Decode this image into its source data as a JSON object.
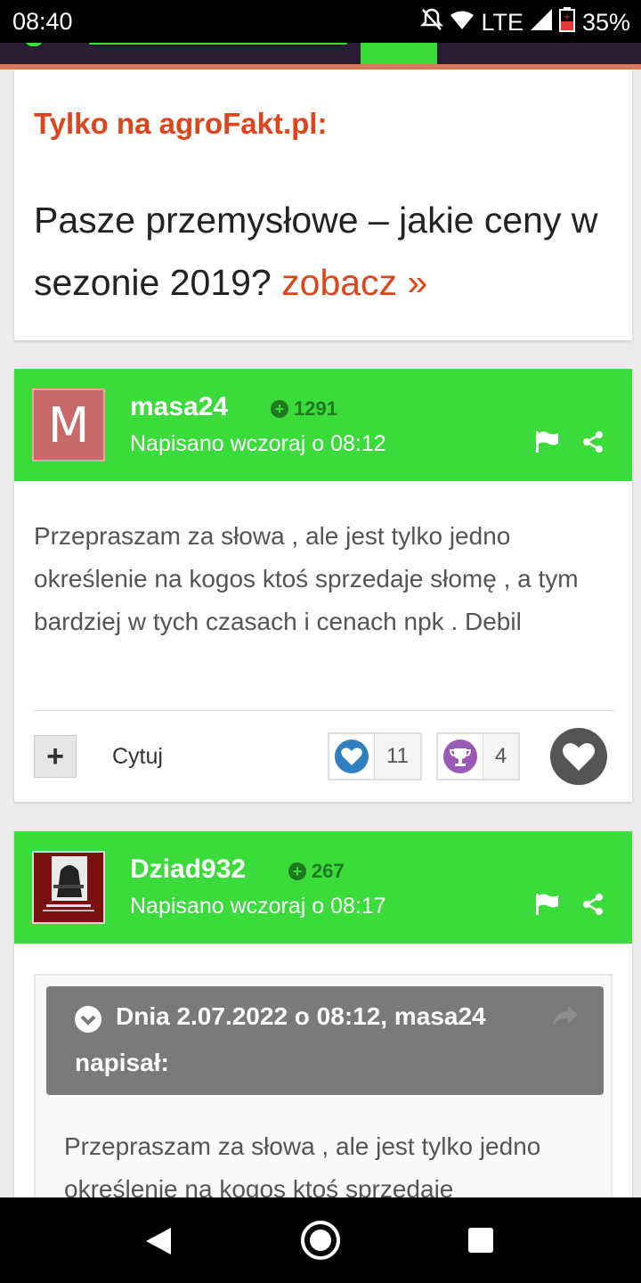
{
  "status_bar": {
    "time": "08:40",
    "network": "LTE",
    "battery": "35%"
  },
  "promo": {
    "label": "Tylko na agroFakt.pl:",
    "headline": "Pasze przemysłowe – jakie ceny w sezonie 2019?",
    "link": "zobacz »"
  },
  "posts": [
    {
      "avatar_letter": "M",
      "author": "masa24",
      "reputation": "1291",
      "posted": "Napisano wczoraj o 08:12",
      "body": "Przepraszam za słowa , ale jest tylko jedno określenie na kogos ktoś sprzedaje słomę , a tym bardziej w tych czasach i cenach npk . Debil",
      "quote_label": "Cytuj",
      "plus_label": "+",
      "reactions": [
        {
          "icon": "heart-icon",
          "count": "11",
          "color": "#2f7fc1"
        },
        {
          "icon": "trophy-icon",
          "count": "4",
          "color": "#9b59b6"
        }
      ]
    },
    {
      "author": "Dziad932",
      "reputation": "267",
      "posted": "Napisano wczoraj o 08:17",
      "quote": {
        "header_line1": "Dnia 2.07.2022 o 08:12, masa24",
        "header_line2": "napisał:",
        "text": "Przepraszam za słowa , ale jest tylko jedno określenie na kogos ktoś sprzedaje"
      }
    }
  ],
  "colors": {
    "accent_green": "#3adb3a",
    "accent_orange": "#e0441b"
  }
}
